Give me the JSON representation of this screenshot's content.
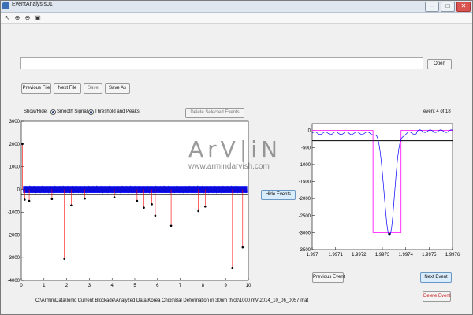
{
  "window": {
    "title": "EventAnalysis01",
    "minimize": "–",
    "maximize": "□",
    "close": "✕"
  },
  "toolbar_icons": [
    "arrow-icon",
    "zoom-in-icon",
    "zoom-out-icon",
    "save-icon"
  ],
  "toolbar_glyphs": [
    "↖",
    "⊕",
    "⊖",
    "▣"
  ],
  "path_field_value": "",
  "buttons": {
    "open": "Open",
    "previous_file": "Previous File",
    "next_file": "Next File",
    "save": "Save",
    "save_as": "Save As",
    "delete_selected": "Delete Selected Events",
    "hide_events": "Hide Events",
    "previous_event": "Previous Event",
    "next_event": "Next Event",
    "delete_event": "Delete Event"
  },
  "show_hide": {
    "label": "Show/Hide:",
    "smooth_signal": "Smooth Signal",
    "threshold_peaks": "Threshold and Peaks"
  },
  "event_counter": "event 4 of 18",
  "file_path": "C:\\Armin\\Data\\Ionic Current Blockade\\Analyzed Data\\Korea Chips\\Bal Deformation in 30nm thick\\1000 mV\\2014_10_06_0057.mat",
  "watermark": {
    "logo": "ArV|iN",
    "url": "www.armindarvish.com"
  },
  "colors": {
    "signal": "#0000ff",
    "events": "#ff0000",
    "markers": "#000000",
    "threshold": "#000000",
    "smooth": "#ff00ff"
  },
  "chart_data": [
    {
      "type": "scatter",
      "title": "",
      "xlim": [
        0,
        10
      ],
      "ylim": [
        -4000,
        3000
      ],
      "x_ticks": [
        0,
        1,
        2,
        3,
        4,
        5,
        6,
        7,
        8,
        9,
        10
      ],
      "y_ticks": [
        3000,
        2000,
        1000,
        0,
        -1000,
        -2000,
        -3000,
        -4000
      ],
      "series": [
        {
          "values_desc": "baseline current noise band",
          "baseline": [
            -150,
            150
          ]
        },
        {
          "events": [
            {
              "x": 0.15,
              "y": -450
            },
            {
              "x": 0.35,
              "y": -500
            },
            {
              "x": 1.35,
              "y": -420
            },
            {
              "x": 1.9,
              "y": -3050
            },
            {
              "x": 2.2,
              "y": -700
            },
            {
              "x": 2.8,
              "y": -400
            },
            {
              "x": 4.1,
              "y": -350
            },
            {
              "x": 5.1,
              "y": -500
            },
            {
              "x": 5.4,
              "y": -800
            },
            {
              "x": 5.75,
              "y": -650
            },
            {
              "x": 5.9,
              "y": -1150
            },
            {
              "x": 6.6,
              "y": -1600
            },
            {
              "x": 7.8,
              "y": -950
            },
            {
              "x": 8.1,
              "y": -750
            },
            {
              "x": 9.3,
              "y": -3450
            },
            {
              "x": 9.75,
              "y": -2550
            },
            {
              "x": 0.05,
              "y": 2000
            }
          ]
        }
      ],
      "threshold": -200
    },
    {
      "type": "line",
      "title": "",
      "xlim": [
        1.997,
        1.9976
      ],
      "ylim": [
        -3500,
        200
      ],
      "x_ticks": [
        "1.997",
        "1.9971",
        "1.9972",
        "1.9973",
        "1.9974",
        "1.9975",
        "1.9976"
      ],
      "y_ticks": [
        0,
        -500,
        -1000,
        -1500,
        -2000,
        -2500,
        -3000,
        -3500
      ],
      "threshold": -300,
      "pulse": {
        "x_start": 1.99726,
        "x_end": 1.99738,
        "level": -3000,
        "baseline": 0
      },
      "peak": {
        "x": 1.99733,
        "y": -3050
      }
    }
  ]
}
